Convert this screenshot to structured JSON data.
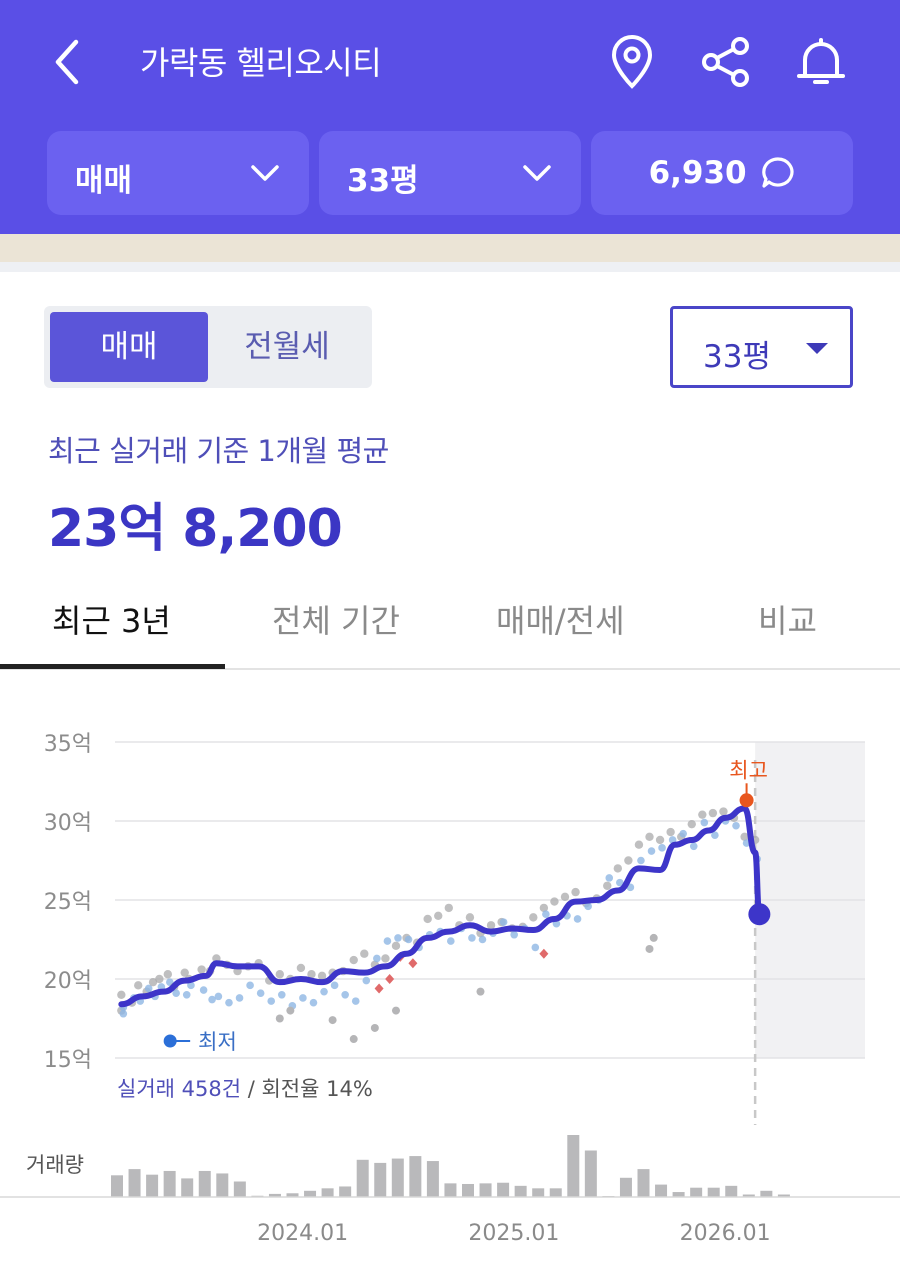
{
  "header": {
    "title": "가락동 헬리오시티",
    "filters": {
      "trade_type": "매매",
      "size": "33평",
      "comments": "6,930"
    }
  },
  "segment": {
    "options": [
      "매매",
      "전월세"
    ],
    "selected": "매매"
  },
  "size_dropdown": "33평",
  "summary": {
    "label": "최근 실거래 기준 1개월 평균",
    "price": "23억 8,200"
  },
  "tabs": [
    "최근 3년",
    "전체 기간",
    "매매/전세",
    "비교"
  ],
  "active_tab": "최근 3년",
  "colors": {
    "brand": "#5a4fe6",
    "line": "#3d35c9",
    "high": "#e8561e",
    "low": "#2b6fd8"
  },
  "chart_data": {
    "type": "line",
    "ylabels": [
      "35억",
      "30억",
      "25억",
      "20억",
      "15억"
    ],
    "yticks": [
      35,
      30,
      25,
      20,
      15
    ],
    "ylim": [
      15,
      35
    ],
    "xlabels": [
      "2024.01",
      "2025.01",
      "2026.01"
    ],
    "xticks": [
      2024.0,
      2025.0,
      2026.0
    ],
    "xlim": [
      2022.97,
      2026.52
    ],
    "grid": true,
    "forecast_shaded_from": 2026.0,
    "high_label": "최고",
    "low_label": "최저",
    "footnote": {
      "deals": "실거래 458건",
      "turnover": " / 회전율 14%"
    },
    "volume_label": "거래량",
    "series": [
      {
        "values": [
          [
            2023.0,
            18.4
          ],
          [
            2023.1,
            18.9
          ],
          [
            2023.2,
            19.2
          ],
          [
            2023.3,
            19.9
          ],
          [
            2023.4,
            20.2
          ],
          [
            2023.45,
            21.0
          ],
          [
            2023.55,
            20.8
          ],
          [
            2023.65,
            20.8
          ],
          [
            2023.75,
            19.8
          ],
          [
            2023.85,
            20.0
          ],
          [
            2023.95,
            19.8
          ],
          [
            2024.05,
            20.5
          ],
          [
            2024.15,
            20.4
          ],
          [
            2024.25,
            20.8
          ],
          [
            2024.35,
            21.6
          ],
          [
            2024.45,
            22.6
          ],
          [
            2024.55,
            23.0
          ],
          [
            2024.65,
            23.4
          ],
          [
            2024.75,
            23.0
          ],
          [
            2024.85,
            23.2
          ],
          [
            2024.95,
            23.1
          ],
          [
            2025.05,
            23.8
          ],
          [
            2025.15,
            24.9
          ],
          [
            2025.25,
            25.0
          ],
          [
            2025.35,
            25.6
          ],
          [
            2025.45,
            27.0
          ],
          [
            2025.55,
            26.9
          ],
          [
            2025.62,
            28.5
          ],
          [
            2025.7,
            28.8
          ],
          [
            2025.78,
            29.4
          ],
          [
            2025.86,
            30.2
          ],
          [
            2025.95,
            30.8
          ],
          [
            2026.0,
            28.0
          ],
          [
            2026.02,
            24.1
          ]
        ]
      }
    ],
    "scatter": {
      "x": [
        2023.0,
        2023.0,
        2023.05,
        2023.08,
        2023.12,
        2023.15,
        2023.18,
        2023.22,
        2023.25,
        2023.3,
        2023.32,
        2023.38,
        2023.42,
        2023.45,
        2023.5,
        2023.55,
        2023.6,
        2023.65,
        2023.7,
        2023.75,
        2023.8,
        2023.85,
        2023.9,
        2023.95,
        2024.0,
        2024.05,
        2024.1,
        2024.15,
        2024.2,
        2024.25,
        2024.3,
        2024.35,
        2024.4,
        2024.45,
        2024.5,
        2024.55,
        2024.6,
        2024.65,
        2024.7,
        2024.75,
        2024.8,
        2024.85,
        2024.9,
        2024.95,
        2025.0,
        2025.05,
        2025.1,
        2025.15,
        2025.2,
        2025.25,
        2025.3,
        2025.35,
        2025.4,
        2025.45,
        2025.5,
        2025.55,
        2025.6,
        2025.65,
        2025.7,
        2025.75,
        2025.8,
        2025.85,
        2025.9,
        2025.95,
        2026.0
      ],
      "gray": [
        18.0,
        19.0,
        18.5,
        19.6,
        19.2,
        19.8,
        20.0,
        20.3,
        19.5,
        20.4,
        20.0,
        20.6,
        20.5,
        21.3,
        20.9,
        20.5,
        20.8,
        21.0,
        19.9,
        20.3,
        20.0,
        20.7,
        20.3,
        20.2,
        20.4,
        20.5,
        21.2,
        21.6,
        20.9,
        21.3,
        22.1,
        22.6,
        22.3,
        23.8,
        24.0,
        24.5,
        23.4,
        23.9,
        22.9,
        23.4,
        23.6,
        23.2,
        23.3,
        23.9,
        24.5,
        24.9,
        25.2,
        25.5,
        24.8,
        25.1,
        25.9,
        27.0,
        27.5,
        28.5,
        29.0,
        28.8,
        29.3,
        29.0,
        29.8,
        30.4,
        30.5,
        30.6,
        30.2,
        29.0,
        28.8
      ],
      "blue": [
        17.8,
        18.2,
        18.8,
        18.6,
        19.4,
        18.9,
        19.5,
        19.8,
        19.1,
        19.0,
        19.6,
        19.3,
        18.7,
        18.9,
        18.5,
        18.8,
        19.6,
        19.1,
        18.6,
        19.0,
        18.3,
        18.8,
        18.5,
        19.2,
        19.6,
        19.0,
        18.6,
        19.9,
        21.3,
        22.4,
        22.6,
        22.5,
        22.0,
        22.8,
        23.0,
        22.4,
        23.2,
        22.6,
        22.5,
        22.9,
        23.6,
        22.8,
        23.2,
        22.0,
        24.1,
        23.5,
        24.0,
        23.8,
        24.6,
        25.0,
        26.4,
        26.1,
        25.8,
        27.5,
        28.1,
        28.3,
        28.8,
        29.2,
        28.4,
        29.9,
        29.1,
        30.0,
        29.7,
        28.6,
        27.6
      ],
      "red": [
        [
          2024.22,
          19.4
        ],
        [
          2024.27,
          20.0
        ],
        [
          2024.32,
          21.4
        ],
        [
          2024.38,
          21.0
        ],
        [
          2025.0,
          21.6
        ]
      ],
      "outliers": [
        [
          2023.75,
          17.5
        ],
        [
          2023.8,
          18.0
        ],
        [
          2024.0,
          17.4
        ],
        [
          2024.1,
          16.2
        ],
        [
          2024.2,
          16.9
        ],
        [
          2024.3,
          18.0
        ],
        [
          2024.7,
          19.2
        ],
        [
          2025.5,
          21.9
        ],
        [
          2025.52,
          22.6
        ]
      ]
    },
    "volume": [
      0.35,
      0.45,
      0.36,
      0.42,
      0.3,
      0.42,
      0.38,
      0.25,
      0.02,
      0.05,
      0.06,
      0.1,
      0.14,
      0.17,
      0.6,
      0.55,
      0.62,
      0.66,
      0.58,
      0.22,
      0.21,
      0.22,
      0.23,
      0.18,
      0.14,
      0.14,
      1.0,
      0.75,
      0.0,
      0.31,
      0.45,
      0.2,
      0.08,
      0.15,
      0.15,
      0.18,
      0.04,
      0.1,
      0.04
    ],
    "high_point": [
      2025.95,
      31.5
    ],
    "low_point": [
      2023.25,
      17.5
    ]
  }
}
